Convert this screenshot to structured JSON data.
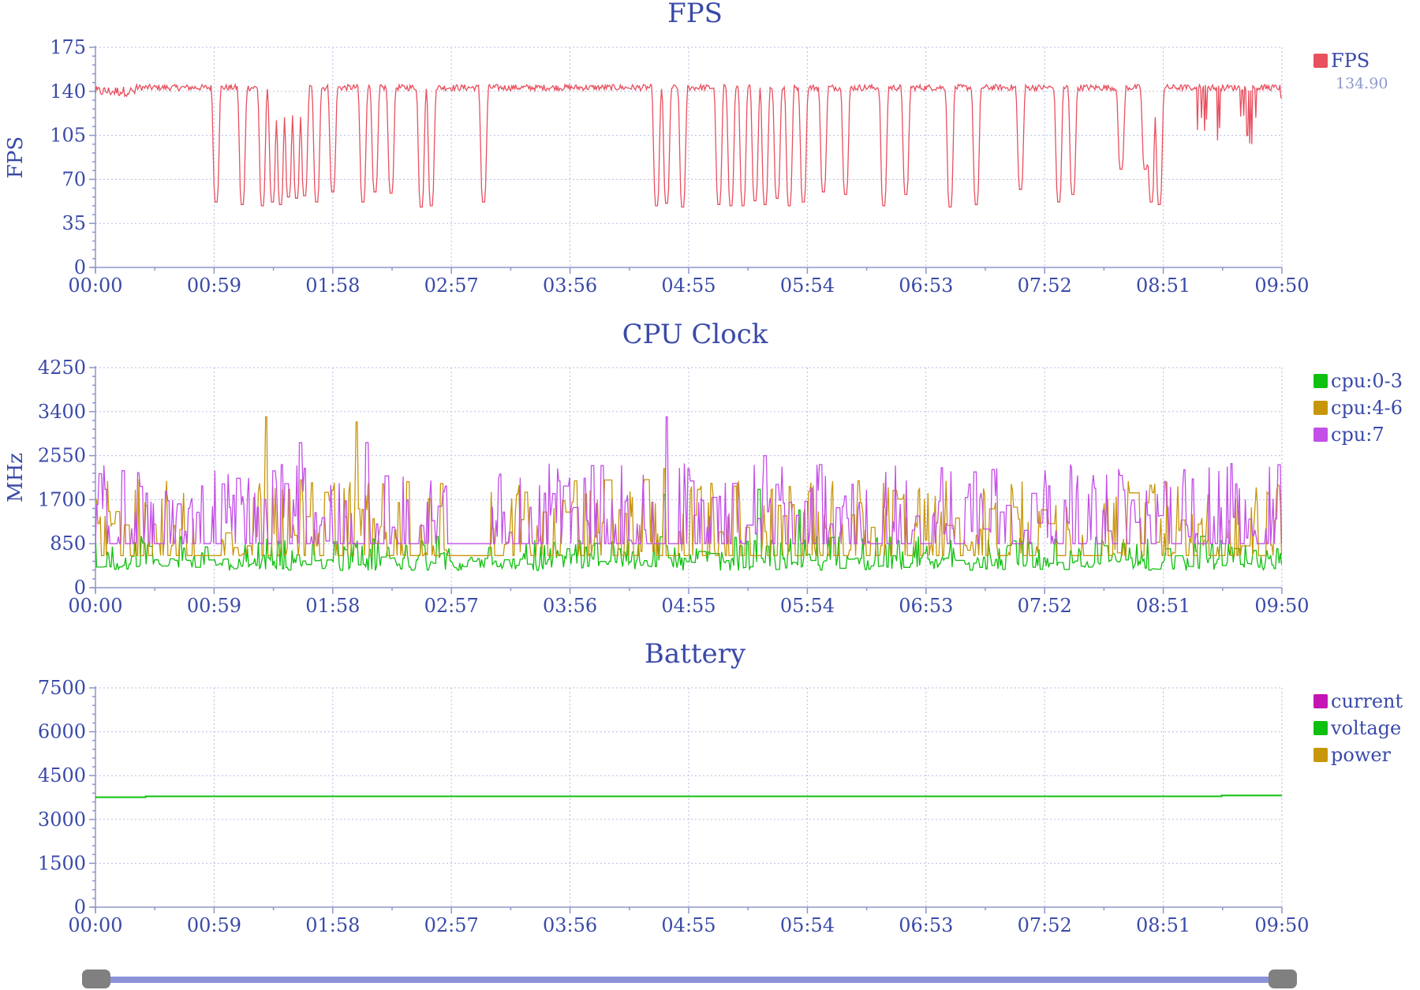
{
  "x_ticks": [
    "00:00",
    "00:59",
    "01:58",
    "02:57",
    "03:56",
    "04:55",
    "05:54",
    "06:53",
    "07:52",
    "08:51",
    "09:50"
  ],
  "chart_data": [
    {
      "type": "line",
      "title": "FPS",
      "ylabel": "FPS",
      "ylim": [
        0,
        175
      ],
      "yticks": [
        0,
        35,
        70,
        105,
        140,
        175
      ],
      "xlim_seconds": [
        0,
        590
      ],
      "grid": true,
      "legend_position": "right",
      "series": [
        {
          "name": "FPS",
          "color": "#e8505f",
          "legend_value": "134.90",
          "baseline": 143,
          "dips": [
            [
              60,
              52
            ],
            [
              73,
              50
            ],
            [
              83,
              49
            ],
            [
              88,
              52
            ],
            [
              92,
              50
            ],
            [
              96,
              56
            ],
            [
              100,
              55
            ],
            [
              104,
              57
            ],
            [
              110,
              52
            ],
            [
              118,
              60
            ],
            [
              133,
              52
            ],
            [
              139,
              60
            ],
            [
              147,
              59
            ],
            [
              162,
              48
            ],
            [
              167,
              49
            ],
            [
              193,
              52
            ],
            [
              279,
              49
            ],
            [
              284,
              51
            ],
            [
              292,
              48
            ],
            [
              310,
              50
            ],
            [
              316,
              49
            ],
            [
              322,
              49
            ],
            [
              328,
              53
            ],
            [
              333,
              50
            ],
            [
              339,
              55
            ],
            [
              345,
              49
            ],
            [
              352,
              52
            ],
            [
              362,
              60
            ],
            [
              373,
              58
            ],
            [
              392,
              49
            ],
            [
              403,
              58
            ],
            [
              425,
              48
            ],
            [
              438,
              50
            ],
            [
              460,
              62
            ],
            [
              479,
              52
            ],
            [
              486,
              58
            ],
            [
              510,
              78
            ],
            [
              522,
              78
            ],
            [
              525,
              52
            ],
            [
              529,
              50
            ]
          ],
          "flat_segments": [
            [
              460,
              500,
              143
            ]
          ],
          "end_value": 135
        }
      ]
    },
    {
      "type": "line",
      "title": "CPU Clock",
      "ylabel": "MHz",
      "ylim": [
        0,
        4250
      ],
      "yticks": [
        0,
        850,
        1700,
        2550,
        3400,
        4250
      ],
      "xlim_seconds": [
        0,
        590
      ],
      "grid": true,
      "legend_position": "right",
      "series": [
        {
          "name": "cpu:0-3",
          "color": "#10c010",
          "base": 330,
          "peak": 1000,
          "spikes": [
            [
              283,
              1800
            ],
            [
              330,
              1900
            ],
            [
              350,
              1500
            ]
          ]
        },
        {
          "name": "cpu:4-6",
          "color": "#c8960a",
          "base": 620,
          "peak": 2100,
          "spikes": [
            [
              85,
              3300
            ],
            [
              130,
              3200
            ],
            [
              283,
              2300
            ],
            [
              300,
              1900
            ]
          ]
        },
        {
          "name": "cpu:7",
          "color": "#c44ee8",
          "base": 850,
          "peak": 2400,
          "spikes": [
            [
              102,
              2800
            ],
            [
              135,
              2800
            ],
            [
              284,
              3300
            ],
            [
              333,
              2550
            ]
          ]
        }
      ]
    },
    {
      "type": "line",
      "title": "Battery",
      "ylabel": "",
      "ylim": [
        0,
        7500
      ],
      "yticks": [
        0,
        1500,
        3000,
        4500,
        6000,
        7500
      ],
      "xlim_seconds": [
        0,
        590
      ],
      "grid": true,
      "legend_position": "right",
      "series": [
        {
          "name": "current",
          "color": "#c414b4",
          "values": []
        },
        {
          "name": "voltage",
          "color": "#10c010",
          "points": [
            [
              0,
              3760
            ],
            [
              25,
              3760
            ],
            [
              25,
              3790
            ],
            [
              560,
              3790
            ],
            [
              560,
              3820
            ],
            [
              590,
              3820
            ]
          ]
        },
        {
          "name": "power",
          "color": "#c8960a",
          "values": []
        }
      ]
    }
  ]
}
